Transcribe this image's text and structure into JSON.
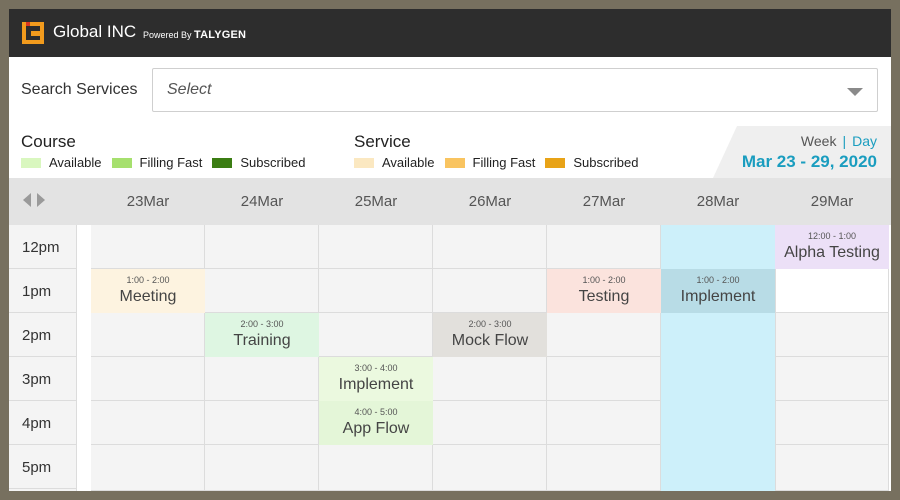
{
  "header": {
    "brand": "Global INC",
    "powered_by": "Powered By",
    "powered_brand": "TALYGEN"
  },
  "search": {
    "label": "Search Services",
    "value": "Select"
  },
  "legend": {
    "course": {
      "title": "Course",
      "items": [
        {
          "label": "Available",
          "color": "#d9f7bf"
        },
        {
          "label": "Filling Fast",
          "color": "#a6e06e"
        },
        {
          "label": "Subscribed",
          "color": "#3b7d13"
        }
      ]
    },
    "service": {
      "title": "Service",
      "items": [
        {
          "label": "Available",
          "color": "#fbe8c1"
        },
        {
          "label": "Filling Fast",
          "color": "#f9c460"
        },
        {
          "label": "Subscribed",
          "color": "#e8a317"
        }
      ]
    }
  },
  "view": {
    "week": "Week",
    "separator": "|",
    "day": "Day",
    "range": "Mar 23 - 29, 2020"
  },
  "calendar": {
    "days": [
      "23Mar",
      "24Mar",
      "25Mar",
      "26Mar",
      "27Mar",
      "28Mar",
      "29Mar"
    ],
    "times": [
      "12pm",
      "1pm",
      "2pm",
      "3pm",
      "4pm",
      "5pm"
    ],
    "events": [
      {
        "day": 6,
        "row": 0,
        "time": "12:00 - 1:00",
        "title": "Alpha Testing",
        "color": "#ece0f7"
      },
      {
        "day": 0,
        "row": 1,
        "time": "1:00 - 2:00",
        "title": "Meeting",
        "color": "#fdf3e0"
      },
      {
        "day": 4,
        "row": 1,
        "time": "1:00 - 2:00",
        "title": "Testing",
        "color": "#fbe3dd"
      },
      {
        "day": 5,
        "row": 1,
        "time": "1:00 - 2:00",
        "title": "Implement",
        "color": "#b8dce6"
      },
      {
        "day": 1,
        "row": 2,
        "time": "2:00 - 3:00",
        "title": "Training",
        "color": "#def6e2"
      },
      {
        "day": 3,
        "row": 2,
        "time": "2:00 - 3:00",
        "title": "Mock Flow",
        "color": "#e2e0dc"
      },
      {
        "day": 2,
        "row": 3,
        "time": "3:00 - 4:00",
        "title": "Implement",
        "color": "#ebf9df"
      },
      {
        "day": 2,
        "row": 4,
        "time": "4:00 - 5:00",
        "title": "App Flow",
        "color": "#e4f6d8"
      }
    ],
    "highlight_day": 5,
    "highlight_color": "#cdf0fa"
  }
}
